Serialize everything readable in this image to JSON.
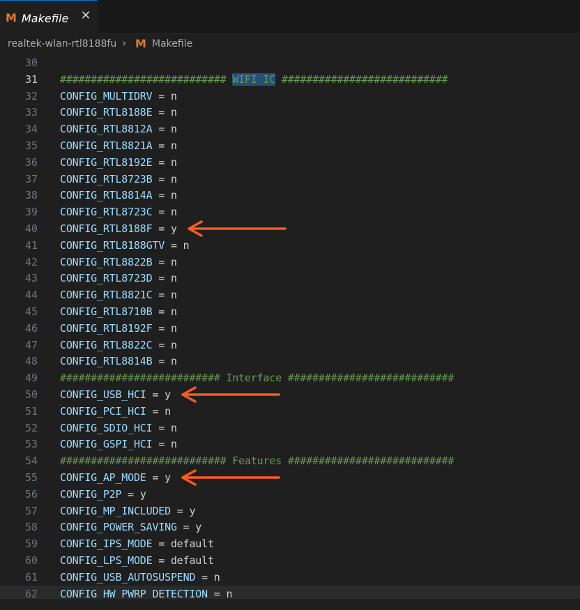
{
  "tab": {
    "icon": "makefile-icon",
    "label": "Makefile",
    "close": "✕"
  },
  "breadcrumb": {
    "folder": "realtek-wlan-rtl8188fu",
    "separator": "›",
    "file": "Makefile"
  },
  "colors": {
    "accent": "#0078d4",
    "makefile_icon": "#e37933",
    "annotation_arrow": "#ff5a1f"
  },
  "lines": [
    {
      "num": "30",
      "text": ""
    },
    {
      "num": "31",
      "comment_before": "########################### ",
      "highlight": "WIFI IC",
      "comment_after": " ###########################",
      "active": true
    },
    {
      "num": "32",
      "var": "CONFIG_MULTIDRV",
      "value": "n"
    },
    {
      "num": "33",
      "var": "CONFIG_RTL8188E",
      "value": "n"
    },
    {
      "num": "34",
      "var": "CONFIG_RTL8812A",
      "value": "n"
    },
    {
      "num": "35",
      "var": "CONFIG_RTL8821A",
      "value": "n"
    },
    {
      "num": "36",
      "var": "CONFIG_RTL8192E",
      "value": "n"
    },
    {
      "num": "37",
      "var": "CONFIG_RTL8723B",
      "value": "n"
    },
    {
      "num": "38",
      "var": "CONFIG_RTL8814A",
      "value": "n"
    },
    {
      "num": "39",
      "var": "CONFIG_RTL8723C",
      "value": "n"
    },
    {
      "num": "40",
      "var": "CONFIG_RTL8188F",
      "value": "y",
      "arrow": true
    },
    {
      "num": "41",
      "var": "CONFIG_RTL8188GTV",
      "value": "n"
    },
    {
      "num": "42",
      "var": "CONFIG_RTL8822B",
      "value": "n"
    },
    {
      "num": "43",
      "var": "CONFIG_RTL8723D",
      "value": "n"
    },
    {
      "num": "44",
      "var": "CONFIG_RTL8821C",
      "value": "n"
    },
    {
      "num": "45",
      "var": "CONFIG_RTL8710B",
      "value": "n"
    },
    {
      "num": "46",
      "var": "CONFIG_RTL8192F",
      "value": "n"
    },
    {
      "num": "47",
      "var": "CONFIG_RTL8822C",
      "value": "n"
    },
    {
      "num": "48",
      "var": "CONFIG_RTL8814B",
      "value": "n"
    },
    {
      "num": "49",
      "comment": "########################## Interface ###########################"
    },
    {
      "num": "50",
      "var": "CONFIG_USB_HCI",
      "value": "y",
      "arrow": true
    },
    {
      "num": "51",
      "var": "CONFIG_PCI_HCI",
      "value": "n"
    },
    {
      "num": "52",
      "var": "CONFIG_SDIO_HCI",
      "value": "n"
    },
    {
      "num": "53",
      "var": "CONFIG_GSPI_HCI",
      "value": "n"
    },
    {
      "num": "54",
      "comment": "########################### Features ###########################"
    },
    {
      "num": "55",
      "var": "CONFIG_AP_MODE",
      "value": "y",
      "arrow": true
    },
    {
      "num": "56",
      "var": "CONFIG_P2P",
      "value": "y"
    },
    {
      "num": "57",
      "var": "CONFIG_MP_INCLUDED",
      "value": "y"
    },
    {
      "num": "58",
      "var": "CONFIG_POWER_SAVING",
      "value": "y"
    },
    {
      "num": "59",
      "var": "CONFIG_IPS_MODE",
      "value": "default"
    },
    {
      "num": "60",
      "var": "CONFIG_LPS_MODE",
      "value": "default"
    },
    {
      "num": "61",
      "var": "CONFIG_USB_AUTOSUSPEND",
      "value": "n"
    },
    {
      "num": "62",
      "var": "CONFIG_HW_PWRP_DETECTION",
      "value": "n",
      "current": true
    }
  ]
}
